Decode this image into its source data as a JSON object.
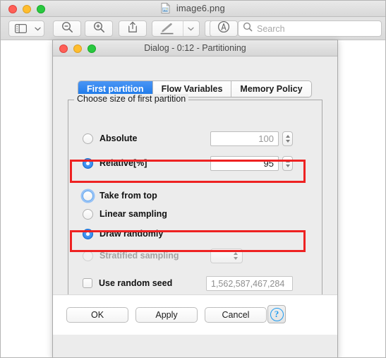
{
  "preview_window": {
    "title": "image6.png",
    "doc_icon": "image-file-icon",
    "toolbar": {
      "sidebar_icon": "sidebar-icon",
      "sidebar_chevron_icon": "chevron-down-icon",
      "zoom_out_icon": "zoom-out-icon",
      "zoom_in_icon": "zoom-in-icon",
      "share_icon": "share-icon",
      "markup_icon": "markup-pen-icon",
      "markup_chevron_icon": "chevron-down-icon",
      "rotate_icon": "rotate-icon",
      "annotate_icon": "annotate-icon",
      "search_icon": "search-icon",
      "search_placeholder": "Search",
      "search_value": ""
    }
  },
  "dialog": {
    "title": "Dialog - 0:12 - Partitioning",
    "tabs": [
      {
        "label": "First partition",
        "active": true
      },
      {
        "label": "Flow Variables",
        "active": false
      },
      {
        "label": "Memory Policy",
        "active": false
      }
    ],
    "group": {
      "legend": "Choose size of first partition",
      "size_options": [
        {
          "label": "Absolute",
          "selected": false,
          "enabled": true,
          "value": "100",
          "value_muted": true,
          "highlighted": false
        },
        {
          "label": "Relative[%]",
          "selected": true,
          "enabled": true,
          "value": "95",
          "value_muted": false,
          "highlighted": true
        }
      ],
      "method_options": [
        {
          "label": "Take from top",
          "selected": false,
          "enabled": true,
          "focused": true,
          "highlighted": false
        },
        {
          "label": "Linear sampling",
          "selected": false,
          "enabled": true,
          "focused": false,
          "highlighted": false
        },
        {
          "label": "Draw randomly",
          "selected": true,
          "enabled": true,
          "focused": false,
          "highlighted": true
        },
        {
          "label": "Stratified sampling",
          "selected": false,
          "enabled": false,
          "focused": false,
          "highlighted": false,
          "has_combo": true,
          "combo_value": ""
        }
      ],
      "seed": {
        "label": "Use random seed",
        "checked": false,
        "value": "1,562,587,467,284"
      }
    },
    "footer": {
      "ok": "OK",
      "apply": "Apply",
      "cancel": "Cancel",
      "help_icon": "help-question-icon",
      "help_glyph": "?"
    }
  },
  "colors": {
    "accent_blue": "#1877e8",
    "highlight_red": "#ee2222",
    "radio_blue": "#1d7cea"
  }
}
